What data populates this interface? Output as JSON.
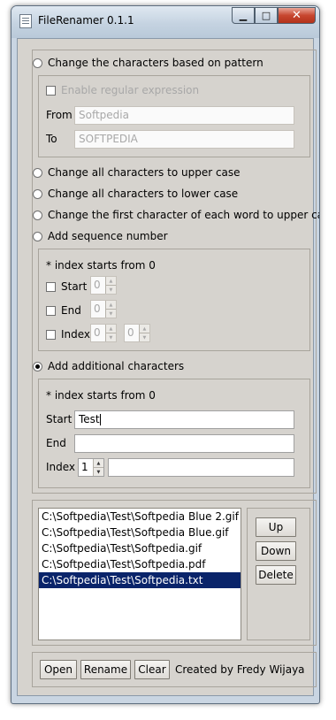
{
  "window": {
    "title": "FileRenamer 0.1.1",
    "min_glyph": "▁",
    "max_glyph": "□",
    "close_glyph": "✕"
  },
  "pattern": {
    "radio_label": "Change the characters based on pattern",
    "regex_label": "Enable regular expression",
    "from_label": "From",
    "from_value": "Softpedia",
    "to_label": "To",
    "to_value": "SOFTPEDIA"
  },
  "options": {
    "upper": "Change all characters to upper case",
    "lower": "Change all characters to lower case",
    "title": "Change the first character of each word to upper case",
    "sequence": "Add sequence number"
  },
  "sequence": {
    "note": "* index starts from 0",
    "start_label": "Start",
    "start_value": "0",
    "end_label": "End",
    "end_value": "0",
    "index_label": "Index",
    "index_value_1": "0",
    "index_value_2": "0"
  },
  "additional": {
    "radio_label": "Add additional characters",
    "note": "* index starts from 0",
    "start_label": "Start",
    "start_value": "Test",
    "end_label": "End",
    "end_value": "",
    "index_label": "Index",
    "index_value": "1",
    "index_text": ""
  },
  "files": [
    "C:\\Softpedia\\Test\\Softpedia Blue 2.gif",
    "C:\\Softpedia\\Test\\Softpedia Blue.gif",
    "C:\\Softpedia\\Test\\Softpedia.gif",
    "C:\\Softpedia\\Test\\Softpedia.pdf",
    "C:\\Softpedia\\Test\\Softpedia.txt"
  ],
  "list_buttons": {
    "up": "Up",
    "down": "Down",
    "delete": "Delete"
  },
  "footer": {
    "open": "Open",
    "rename": "Rename",
    "clear": "Clear",
    "credit": "Created by Fredy Wijaya"
  },
  "colors": {
    "selection": "#0a246a",
    "client_bg": "#d6d3ce"
  }
}
